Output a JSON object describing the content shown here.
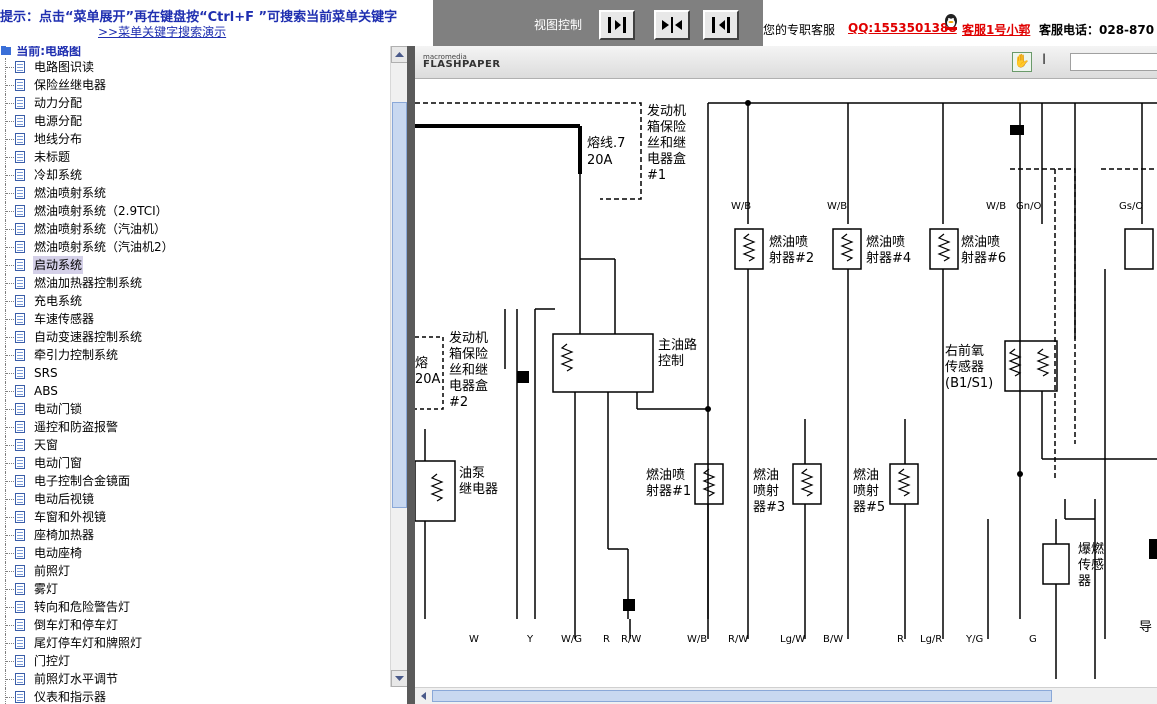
{
  "header": {
    "hint": "提示：点击“菜单展开”再在键盘按“Ctrl+F ”可搜索当前菜单关键字",
    "demo_link": ">>菜单关键字搜索演示",
    "view_control_label": "视图控制",
    "service_label": "您的专职客服",
    "qq": "QQ:1553501388",
    "cs_name": "客服1号小郭",
    "phone": "客服电话：028-870"
  },
  "tree": {
    "root_label": "当前:电路图",
    "selected_index": 11,
    "items": [
      "电路图识读",
      "保险丝继电器",
      "动力分配",
      "电源分配",
      "地线分布",
      "未标题",
      "冷却系统",
      "燃油喷射系统",
      "燃油喷射系统（2.9TCI）",
      "燃油喷射系统（汽油机）",
      "燃油喷射系统（汽油机2）",
      "启动系统",
      "燃油加热器控制系统",
      "充电系统",
      "车速传感器",
      "自动变速器控制系统",
      "牵引力控制系统",
      "SRS",
      "ABS",
      "电动门锁",
      "遥控和防盗报警",
      "天窗",
      "电动门窗",
      "电子控制合金镜面",
      "电动后视镜",
      "车窗和外视镜",
      "座椅加热器",
      "电动座椅",
      "前照灯",
      "雾灯",
      "转向和危险警告灯",
      "倒车灯和停车灯",
      "尾灯停车灯和牌照灯",
      "门控灯",
      "前照灯水平调节",
      "仪表和指示器"
    ]
  },
  "viewer": {
    "logo_top": "macromedia",
    "logo_bottom": "FLASHPAPER",
    "diagram": {
      "labels": {
        "fuse_box1": [
          "发动机",
          "箱保险",
          "丝和继",
          "电器盒",
          "#1"
        ],
        "fuse_line": [
          "熔线.7",
          "20A"
        ],
        "fuse_box2": [
          "发动机",
          "箱保险",
          "丝和继",
          "电器盒",
          "#2"
        ],
        "fuse_left": [
          "熔",
          "20A"
        ],
        "main_relay": [
          "主油路",
          "控制"
        ],
        "pump_relay": [
          "油泵",
          "继电器"
        ],
        "inj2": [
          "燃油喷",
          "射器#2"
        ],
        "inj4": [
          "燃油喷",
          "射器#4"
        ],
        "inj6": [
          "燃油喷",
          "射器#6"
        ],
        "inj1": [
          "燃油喷",
          "射器#1"
        ],
        "inj3": [
          "燃油",
          "喷射",
          "器#3"
        ],
        "inj5": [
          "燃油",
          "喷射",
          "器#5"
        ],
        "o2": [
          "右前氧",
          "传感器",
          "(B1/S1)"
        ],
        "knock": [
          "爆燃",
          "传感",
          "器"
        ],
        "guide": "导"
      },
      "wire_codes": [
        "W",
        "Y",
        "W/G",
        "R",
        "R/W",
        "W/B",
        "R/W",
        "Lg/W",
        "B/W",
        "R",
        "Lg/R",
        "Y/G",
        "G"
      ],
      "top_wire_codes": [
        "W/B",
        "W/B",
        "W/B",
        "Gn/O",
        "Gs/O"
      ]
    }
  }
}
